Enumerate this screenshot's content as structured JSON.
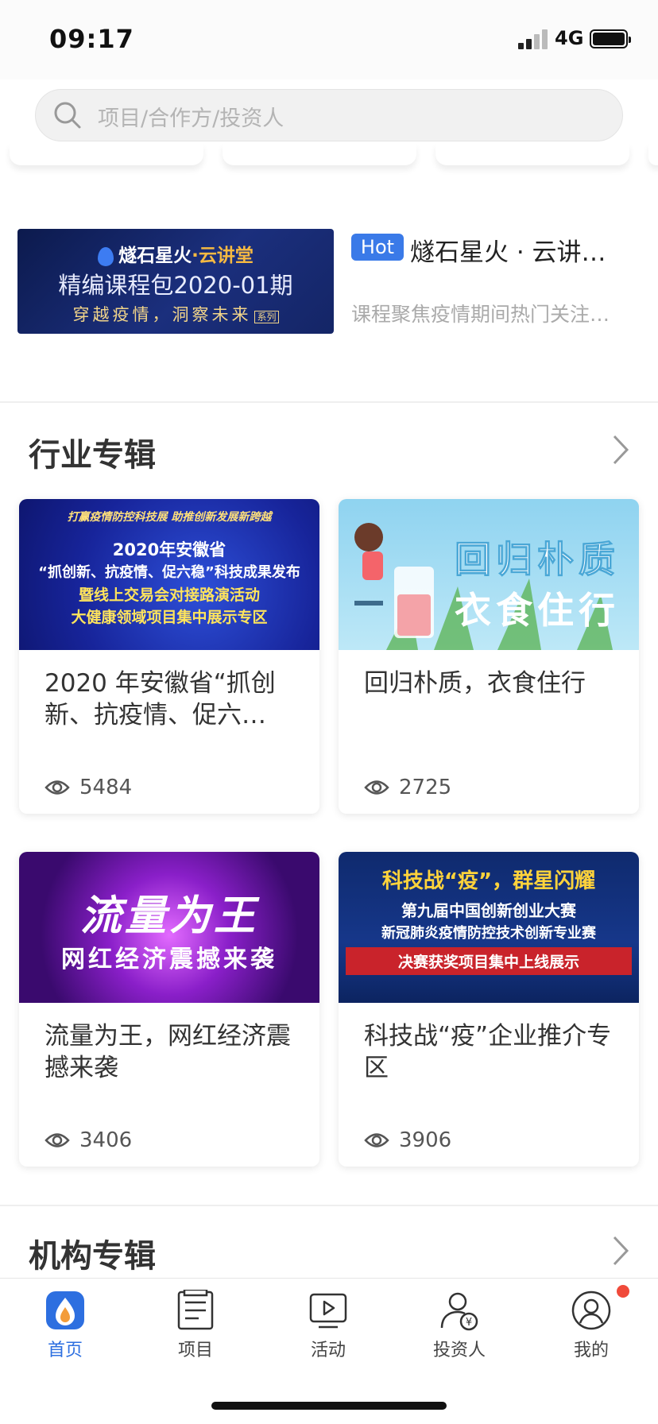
{
  "status_bar": {
    "time": "09:17",
    "network": "4G"
  },
  "search": {
    "placeholder": "项目/合作方/投资人"
  },
  "featured": {
    "banner_line1_a": "燧石星火",
    "banner_line1_b": "·云讲堂",
    "banner_line2": "精编课程包2020-01期",
    "banner_line3": "穿越疫情，洞察未来",
    "banner_tag": "系列",
    "badge": "Hot",
    "title": "燧石星火 · 云讲…",
    "description": "课程聚焦疫情期间热门关注…"
  },
  "industry_section": {
    "title": "行业专辑",
    "cards": [
      {
        "banner_top": "打赢疫情防控科技展 助推创新发展新跨越",
        "banner_lines": [
          "2020年安徽省",
          "“抓创新、抗疫情、促六稳”科技成果发布",
          "暨线上交易会对接路演活动",
          "大健康领域项目集中展示专区"
        ],
        "title": "2020 年安徽省“抓创新、抗疫情、促六…",
        "views": "5484"
      },
      {
        "banner_lines": [
          "回归朴质",
          "衣食住行"
        ],
        "title": "回归朴质，衣食住行",
        "views": "2725"
      },
      {
        "banner_lines": [
          "流量为王",
          "网红经济震撼来袭"
        ],
        "title": "流量为王，网红经济震撼来袭",
        "views": "3406"
      },
      {
        "banner_lines": [
          "科技战“疫”，群星闪耀",
          "第九届中国创新创业大赛",
          "新冠肺炎疫情防控技术创新专业赛",
          "决赛获奖项目集中上线展示"
        ],
        "title": "科技战“疫”企业推介专区",
        "views": "3906"
      }
    ]
  },
  "org_section": {
    "title": "机构专辑"
  },
  "tab_bar": {
    "tabs": [
      {
        "label": "首页",
        "icon": "home-logo-icon",
        "active": true
      },
      {
        "label": "项目",
        "icon": "document-icon"
      },
      {
        "label": "活动",
        "icon": "video-play-icon"
      },
      {
        "label": "投资人",
        "icon": "investor-icon"
      },
      {
        "label": "我的",
        "icon": "profile-icon",
        "badge": true
      }
    ]
  },
  "colors": {
    "accent": "#2d6fe0",
    "hot_badge": "#3a7ae8",
    "notification_dot": "#f04a3a"
  }
}
